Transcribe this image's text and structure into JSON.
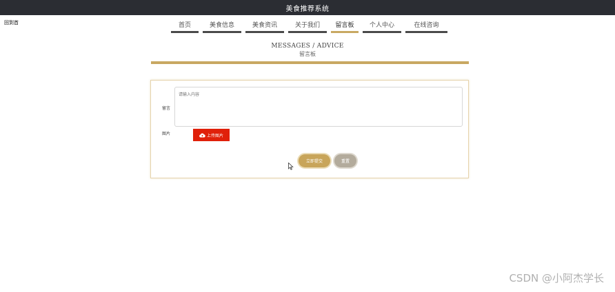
{
  "app": {
    "title": "美食推荐系统"
  },
  "back_link": "回到首",
  "nav": {
    "items": [
      {
        "label": "首页"
      },
      {
        "label": "美食信息"
      },
      {
        "label": "美食资讯"
      },
      {
        "label": "关于我们"
      },
      {
        "label": "留言板"
      },
      {
        "label": "个人中心"
      },
      {
        "label": "在线咨询"
      }
    ],
    "active": "留言板"
  },
  "heading": {
    "english": "MESSAGES / ADVICE",
    "chinese": "留言板"
  },
  "form": {
    "message_label": "留言",
    "message_placeholder": "请输入内容",
    "image_label": "图片",
    "upload_label": "上传图片",
    "submit_label": "立即提交",
    "reset_label": "重置"
  },
  "watermark": "CSDN @小阿杰学长",
  "colors": {
    "accent": "#c8a862",
    "topbar": "#2b2d33",
    "upload": "#e0200a",
    "reset": "#b3ab9c"
  },
  "icons": {
    "upload": "cloud-upload-icon",
    "cursor": "mouse-pointer-icon"
  }
}
